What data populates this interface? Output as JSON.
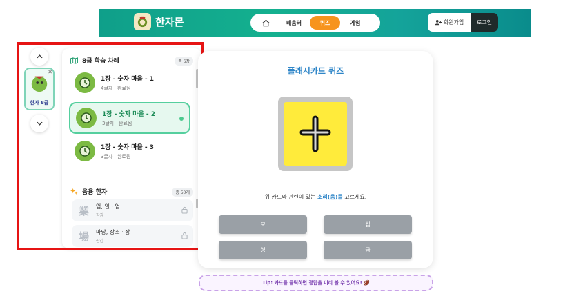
{
  "app": {
    "logo_text": "한자몬"
  },
  "nav": {
    "home_icon": "home-icon",
    "learn": "배움터",
    "quiz": "퀴즈",
    "game": "게임",
    "active_color": "#f7941d"
  },
  "auth": {
    "signup": "회원가입",
    "login": "로그인"
  },
  "book": {
    "label": "한자 8급"
  },
  "chapters_section": {
    "title": "8급 학습 차례",
    "count": "총 6장",
    "items": [
      {
        "title": "1장 - 숫자 마을 - 1",
        "sub": "4글자 · 완료됨"
      },
      {
        "title": "1장 - 숫자 마을 - 2",
        "sub": "3글자 · 완료됨"
      },
      {
        "title": "1장 - 숫자 마을 - 3",
        "sub": "3글자 · 완료됨"
      }
    ]
  },
  "applied_section": {
    "title": "응용 한자",
    "count": "총 50개",
    "items": [
      {
        "hanja": "業",
        "title": "업, 일 · 업",
        "sub": "잠김"
      },
      {
        "hanja": "場",
        "title": "마당, 장소 · 장",
        "sub": "잠김"
      }
    ]
  },
  "quiz": {
    "title": "플래시카드 퀴즈",
    "card_char": "十",
    "card_color": "#ffeb3b",
    "instruction_pre": "위 카드와 관련이 있는 ",
    "instruction_hl": "소리(음)를",
    "instruction_post": " 고르세요.",
    "options": [
      "모",
      "십",
      "형",
      "금"
    ]
  },
  "tip": "Tip: 카드를 클릭하면 정답을 미리 볼 수 있어요! 🏈"
}
